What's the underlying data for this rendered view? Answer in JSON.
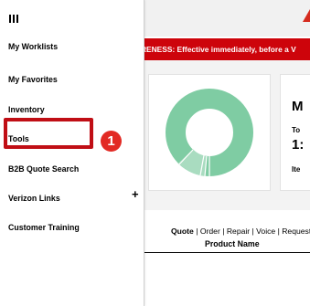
{
  "menu": {
    "items": [
      {
        "label": "My Worklists"
      },
      {
        "label": "My Favorites"
      },
      {
        "label": "Inventory"
      },
      {
        "label": "Tools"
      },
      {
        "label": "B2B Quote Search"
      },
      {
        "label": "Verizon Links",
        "expand_symbol": "+"
      },
      {
        "label": "Customer Training"
      }
    ]
  },
  "alert": {
    "text": "RENESS: Effective immediately, before a V"
  },
  "kpi": {
    "heading": "M",
    "sub": "To",
    "value": "1:",
    "sub2": "Ite"
  },
  "links": {
    "quote": "Quote",
    "sep": " | ",
    "items": [
      "Order",
      "Repair",
      "Voice",
      "Request"
    ]
  },
  "table": {
    "product_name_header": "Product Name"
  },
  "annotation": {
    "step_number": "1"
  },
  "colors": {
    "brand_red": "#cd040b",
    "highlight_red": "#c00e15",
    "donut_green": "#7fcca3",
    "donut_green_light": "#a9dcc0"
  },
  "icons": {
    "menu": "hamburger-icon",
    "expand": "plus-icon"
  }
}
